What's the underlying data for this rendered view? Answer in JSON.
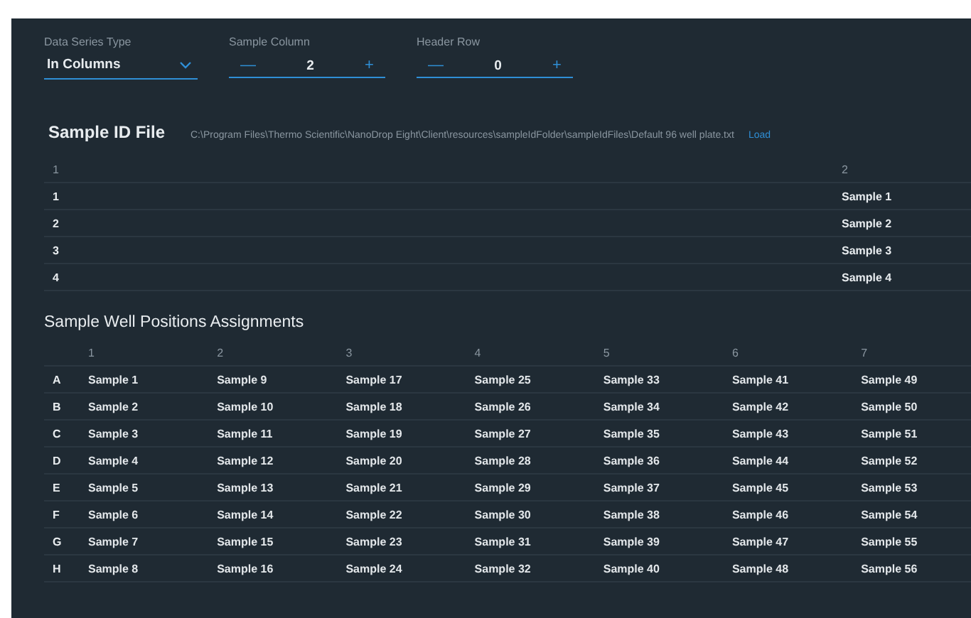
{
  "controls": {
    "data_series_type": {
      "label": "Data Series Type",
      "value": "In Columns"
    },
    "sample_column": {
      "label": "Sample Column",
      "minus": "—",
      "value": "2",
      "plus": "+"
    },
    "header_row": {
      "label": "Header Row",
      "minus": "—",
      "value": "0",
      "plus": "+"
    }
  },
  "sample_id_file": {
    "title": "Sample ID File",
    "path": "C:\\Program Files\\Thermo Scientific\\NanoDrop Eight\\Client\\resources\\sampleIdFolder\\sampleIdFiles\\Default 96 well plate.txt",
    "load": "Load",
    "columns": [
      "1",
      "2"
    ],
    "rows": [
      [
        "1",
        "Sample 1"
      ],
      [
        "2",
        "Sample 2"
      ],
      [
        "3",
        "Sample 3"
      ],
      [
        "4",
        "Sample 4"
      ]
    ]
  },
  "well_positions": {
    "title": "Sample Well Positions Assignments",
    "columns": [
      "1",
      "2",
      "3",
      "4",
      "5",
      "6",
      "7"
    ],
    "rows": [
      {
        "label": "A",
        "cells": [
          "Sample 1",
          "Sample 9",
          "Sample 17",
          "Sample 25",
          "Sample 33",
          "Sample 41",
          "Sample 49"
        ]
      },
      {
        "label": "B",
        "cells": [
          "Sample 2",
          "Sample 10",
          "Sample 18",
          "Sample 26",
          "Sample 34",
          "Sample 42",
          "Sample 50"
        ]
      },
      {
        "label": "C",
        "cells": [
          "Sample 3",
          "Sample 11",
          "Sample 19",
          "Sample 27",
          "Sample 35",
          "Sample 43",
          "Sample 51"
        ]
      },
      {
        "label": "D",
        "cells": [
          "Sample 4",
          "Sample 12",
          "Sample 20",
          "Sample 28",
          "Sample 36",
          "Sample 44",
          "Sample 52"
        ]
      },
      {
        "label": "E",
        "cells": [
          "Sample 5",
          "Sample 13",
          "Sample 21",
          "Sample 29",
          "Sample 37",
          "Sample 45",
          "Sample 53"
        ]
      },
      {
        "label": "F",
        "cells": [
          "Sample 6",
          "Sample 14",
          "Sample 22",
          "Sample 30",
          "Sample 38",
          "Sample 46",
          "Sample 54"
        ]
      },
      {
        "label": "G",
        "cells": [
          "Sample 7",
          "Sample 15",
          "Sample 23",
          "Sample 31",
          "Sample 39",
          "Sample 47",
          "Sample 55"
        ]
      },
      {
        "label": "H",
        "cells": [
          "Sample 8",
          "Sample 16",
          "Sample 24",
          "Sample 32",
          "Sample 40",
          "Sample 48",
          "Sample 56"
        ]
      }
    ]
  }
}
